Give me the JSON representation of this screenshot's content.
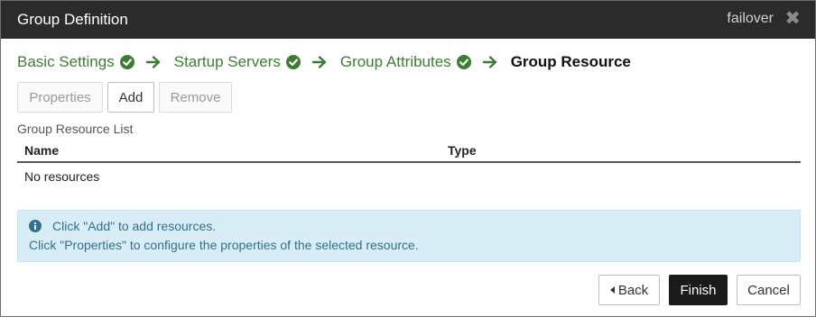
{
  "dialog": {
    "title": "Group Definition",
    "group_name": "failover",
    "close_glyph": "✖"
  },
  "wizard": {
    "steps": [
      {
        "label": "Basic Settings",
        "state": "done"
      },
      {
        "label": "Startup Servers",
        "state": "done"
      },
      {
        "label": "Group Attributes",
        "state": "done"
      },
      {
        "label": "Group Resource",
        "state": "current"
      }
    ],
    "done_color": "#3c7d33"
  },
  "toolbar": {
    "properties_label": "Properties",
    "add_label": "Add",
    "remove_label": "Remove"
  },
  "resource_list": {
    "title": "Group Resource List",
    "columns": [
      "Name",
      "Type"
    ],
    "empty_text": "No resources"
  },
  "info": {
    "line1": "Click \"Add\" to add resources.",
    "line2": "Click \"Properties\" to configure the properties of the selected resource.",
    "icon": "info-circle-icon"
  },
  "footer": {
    "back_label": "Back",
    "finish_label": "Finish",
    "cancel_label": "Cancel"
  }
}
